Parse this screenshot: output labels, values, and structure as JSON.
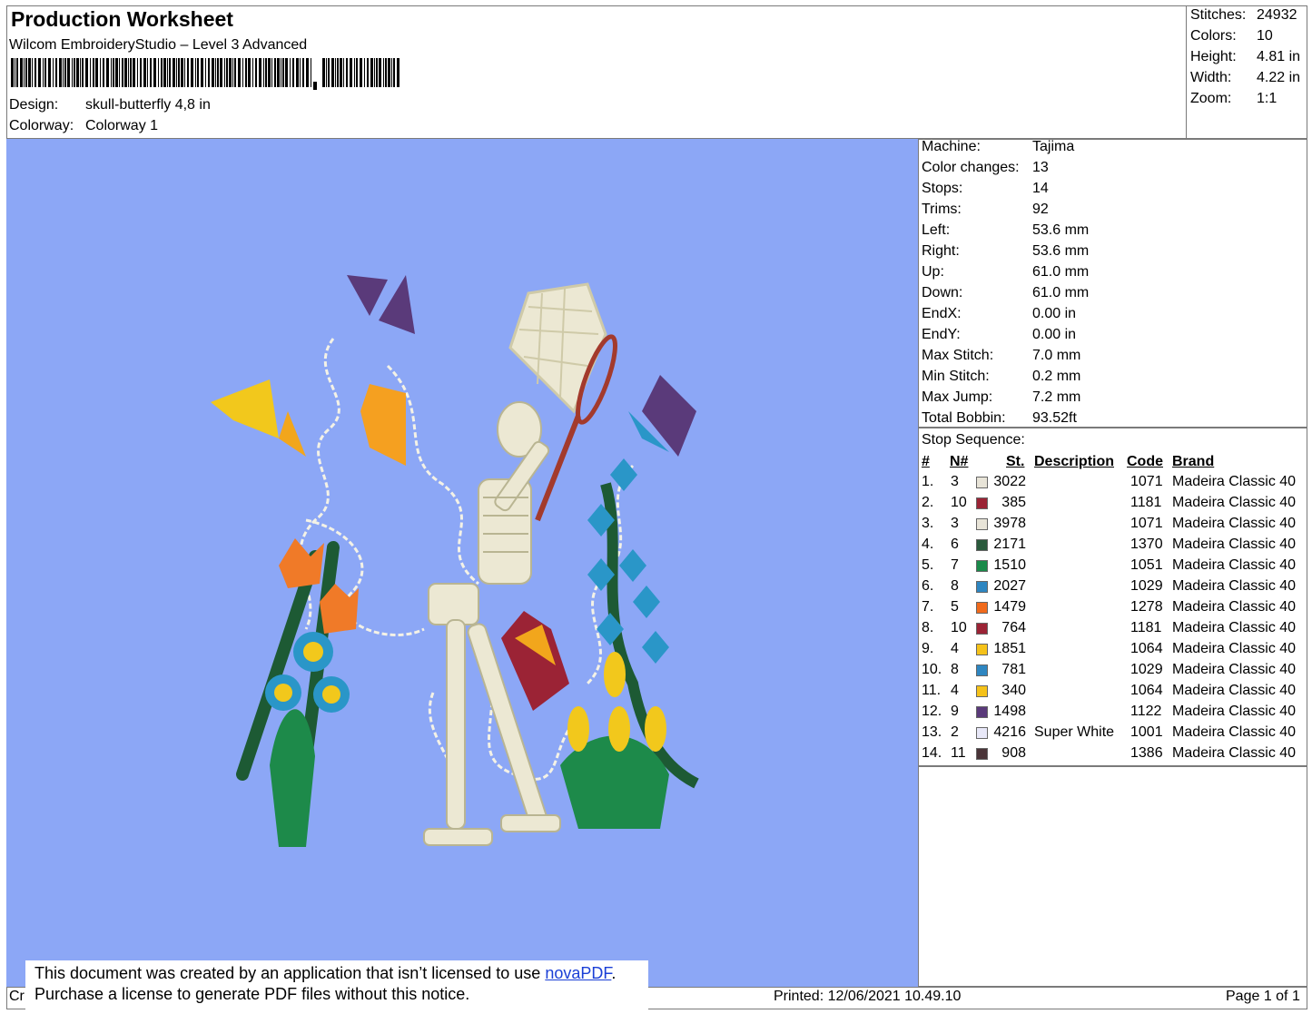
{
  "header": {
    "title": "Production Worksheet",
    "subtitle": "Wilcom EmbroideryStudio – Level 3 Advanced",
    "design_label": "Design:",
    "design_value": "skull-butterfly 4,8 in",
    "colorway_label": "Colorway:",
    "colorway_value": "Colorway 1"
  },
  "stats": [
    {
      "label": "Stitches:",
      "value": "24932"
    },
    {
      "label": "Colors:",
      "value": "10"
    },
    {
      "label": "Height:",
      "value": "4.81 in"
    },
    {
      "label": "Width:",
      "value": "4.22 in"
    },
    {
      "label": "Zoom:",
      "value": "1:1"
    }
  ],
  "machine_info": [
    {
      "label": "Machine:",
      "value": "Tajima"
    },
    {
      "label": "Color changes:",
      "value": "13"
    },
    {
      "label": "Stops:",
      "value": "14"
    },
    {
      "label": "Trims:",
      "value": "92"
    },
    {
      "label": "Left:",
      "value": "53.6 mm"
    },
    {
      "label": "Right:",
      "value": "53.6 mm"
    },
    {
      "label": "Up:",
      "value": "61.0 mm"
    },
    {
      "label": "Down:",
      "value": "61.0 mm"
    },
    {
      "label": "EndX:",
      "value": "0.00 in"
    },
    {
      "label": "EndY:",
      "value": "0.00 in"
    },
    {
      "label": "Max Stitch:",
      "value": "7.0 mm"
    },
    {
      "label": "Min Stitch:",
      "value": "0.2 mm"
    },
    {
      "label": "Max Jump:",
      "value": "7.2 mm"
    },
    {
      "label": "Total Bobbin:",
      "value": "93.52ft"
    }
  ],
  "stop_sequence": {
    "title": "Stop Sequence:",
    "headers": {
      "num": "#",
      "n": "N#",
      "st": "St.",
      "description": "Description",
      "code": "Code",
      "brand": "Brand"
    },
    "rows": [
      {
        "num": "1.",
        "n": "3",
        "color": "#e8e4d8",
        "st": "3022",
        "description": "",
        "code": "1071",
        "brand": "Madeira Classic 40"
      },
      {
        "num": "2.",
        "n": "10",
        "color": "#9b2335",
        "st": "385",
        "description": "",
        "code": "1181",
        "brand": "Madeira Classic 40"
      },
      {
        "num": "3.",
        "n": "3",
        "color": "#e8e4d8",
        "st": "3978",
        "description": "",
        "code": "1071",
        "brand": "Madeira Classic 40"
      },
      {
        "num": "4.",
        "n": "6",
        "color": "#2a5a3c",
        "st": "2171",
        "description": "",
        "code": "1370",
        "brand": "Madeira Classic 40"
      },
      {
        "num": "5.",
        "n": "7",
        "color": "#1a8a4a",
        "st": "1510",
        "description": "",
        "code": "1051",
        "brand": "Madeira Classic 40"
      },
      {
        "num": "6.",
        "n": "8",
        "color": "#2e86c1",
        "st": "2027",
        "description": "",
        "code": "1029",
        "brand": "Madeira Classic 40"
      },
      {
        "num": "7.",
        "n": "5",
        "color": "#f06a1c",
        "st": "1479",
        "description": "",
        "code": "1278",
        "brand": "Madeira Classic 40"
      },
      {
        "num": "8.",
        "n": "10",
        "color": "#9b2335",
        "st": "764",
        "description": "",
        "code": "1181",
        "brand": "Madeira Classic 40"
      },
      {
        "num": "9.",
        "n": "4",
        "color": "#f5c21a",
        "st": "1851",
        "description": "",
        "code": "1064",
        "brand": "Madeira Classic 40"
      },
      {
        "num": "10.",
        "n": "8",
        "color": "#2e86c1",
        "st": "781",
        "description": "",
        "code": "1029",
        "brand": "Madeira Classic 40"
      },
      {
        "num": "11.",
        "n": "4",
        "color": "#f5c21a",
        "st": "340",
        "description": "",
        "code": "1064",
        "brand": "Madeira Classic 40"
      },
      {
        "num": "12.",
        "n": "9",
        "color": "#5a3a7a",
        "st": "1498",
        "description": "",
        "code": "1122",
        "brand": "Madeira Classic 40"
      },
      {
        "num": "13.",
        "n": "2",
        "color": "#e8e8f8",
        "st": "4216",
        "description": "Super White",
        "code": "1001",
        "brand": "Madeira Classic 40"
      },
      {
        "num": "14.",
        "n": "11",
        "color": "#4a3438",
        "st": "908",
        "description": "",
        "code": "1386",
        "brand": "Madeira Classic 40"
      }
    ]
  },
  "footer": {
    "created_prefix": "Cr",
    "printed": "Printed: 12/06/2021 10.49.10",
    "page": "Page 1 of 1"
  },
  "notice": {
    "line1_prefix": "This document was created by an application that isn’t licensed to use ",
    "link": "novaPDF",
    "line1_suffix": ".",
    "line2": "Purchase a license to generate PDF files without this notice."
  },
  "colors": {
    "canvas_background": "#8ca7f6"
  }
}
